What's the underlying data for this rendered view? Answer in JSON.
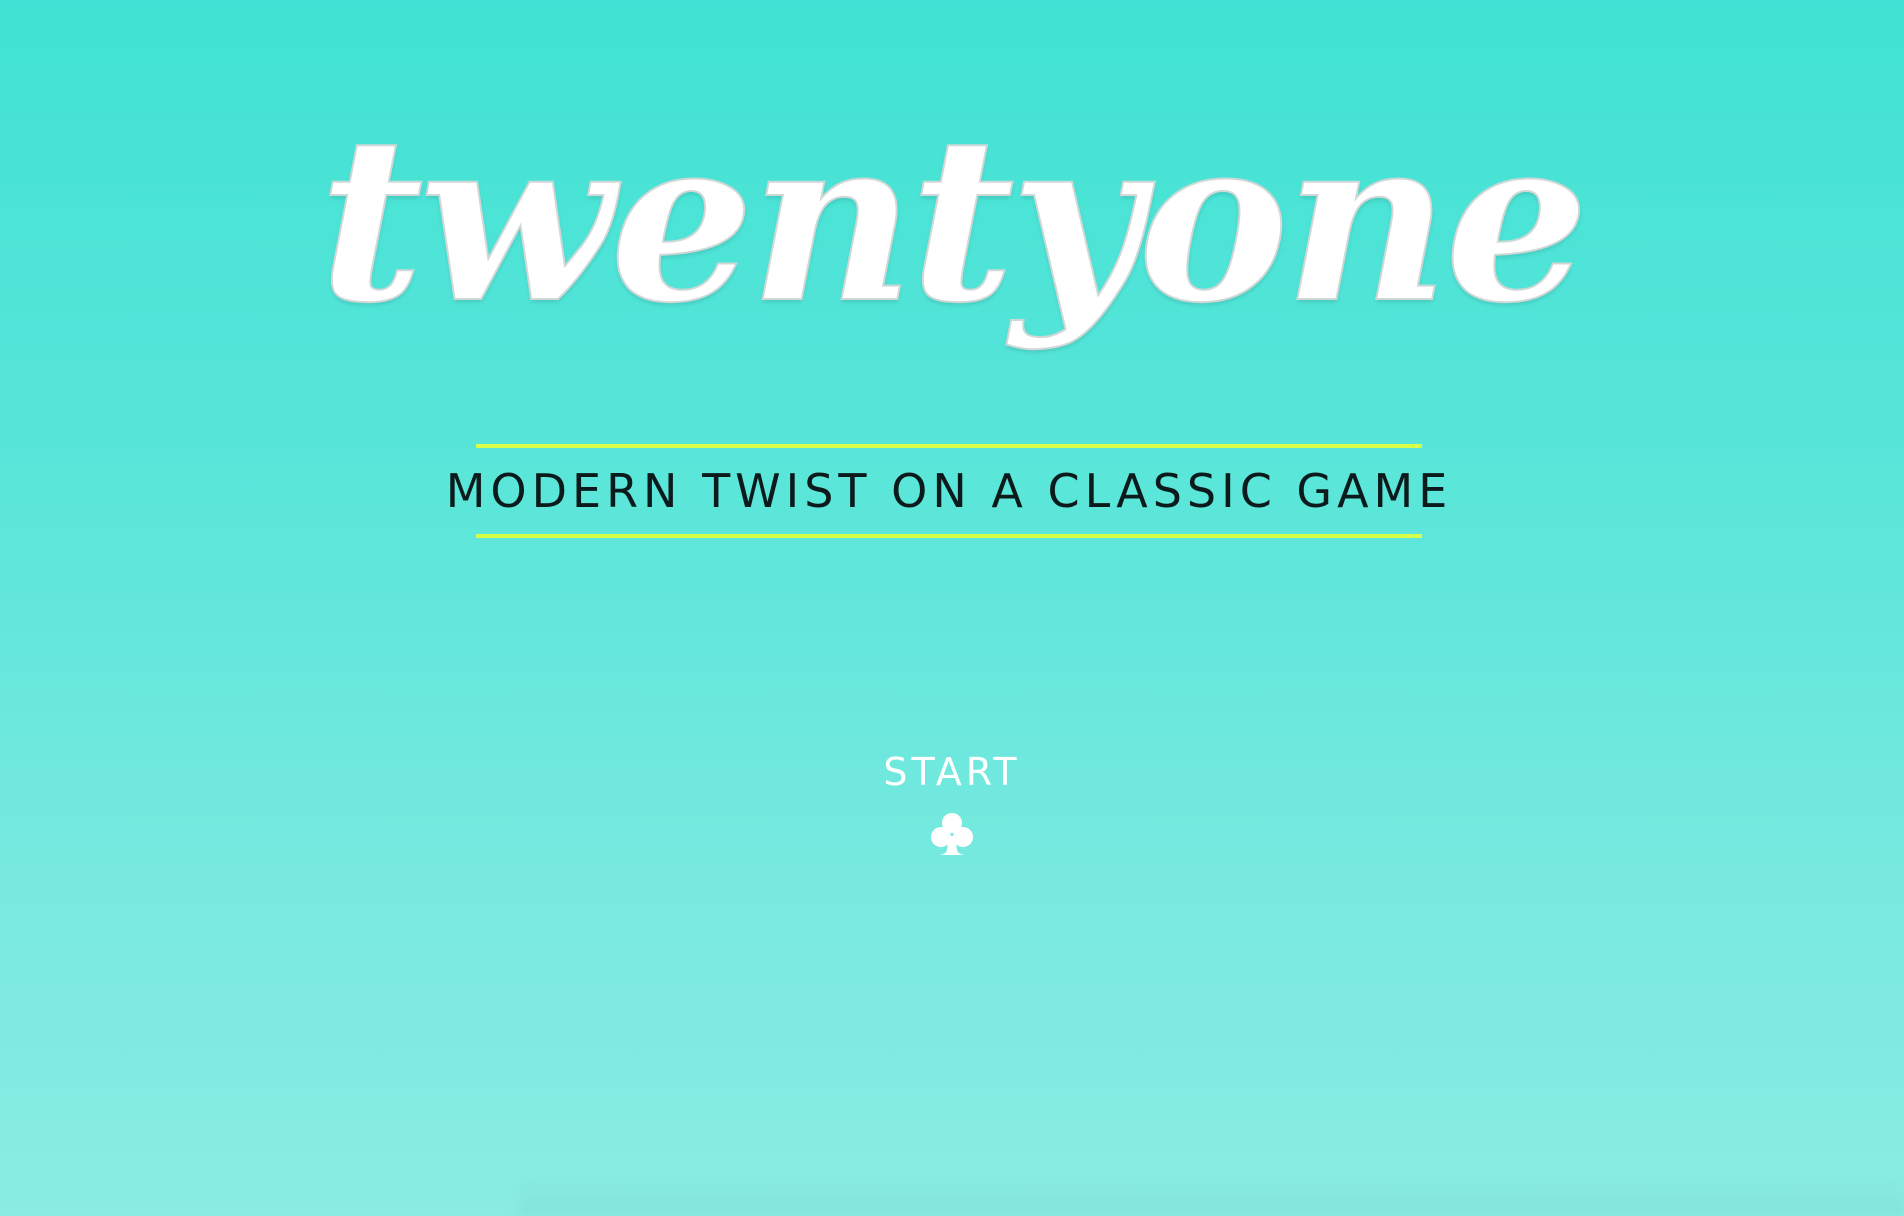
{
  "logo": {
    "text": "twentyone"
  },
  "tagline": {
    "text": "MODERN TWIST ON A CLASSIC GAME"
  },
  "start": {
    "label": "START",
    "icon": "club-icon"
  },
  "colors": {
    "background_top": "#3fe2d4",
    "background_bottom": "#8aece2",
    "accent_rule": "#d7ff4a",
    "tagline_text": "#0b1b1c",
    "logo_text": "#ffffff"
  }
}
